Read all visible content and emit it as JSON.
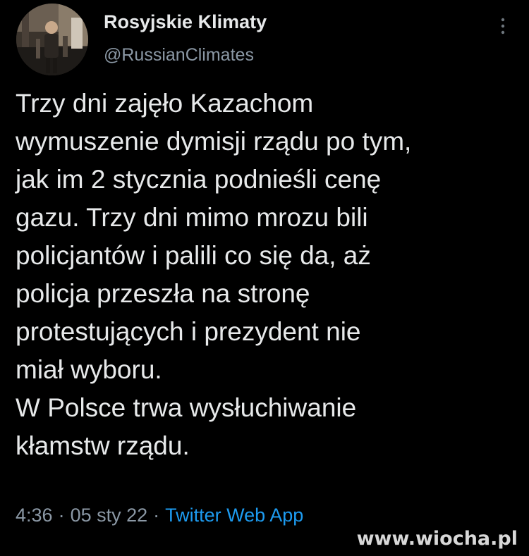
{
  "author": {
    "display_name": "Rosyjskie Klimaty",
    "handle": "@RussianClimates"
  },
  "icons": {
    "more": "vertical-ellipsis",
    "avatar": "profile-photo"
  },
  "tweet": {
    "lines": [
      "Trzy dni zajęło Kazachom",
      "wymuszenie dymisji rządu po tym,",
      "jak im 2 stycznia podnieśli cenę",
      "gazu. Trzy dni mimo mrozu bili",
      "policjantów i palili co się da, aż",
      "policja przeszła na stronę",
      "protestujących i prezydent nie",
      "miał wyboru.",
      "W Polsce trwa wysłuchiwanie",
      "kłamstw rządu."
    ]
  },
  "meta": {
    "time": "4:36",
    "date": "05 sty 22",
    "separator": "·",
    "source": "Twitter Web App"
  },
  "watermark": "www.wiocha.pl",
  "colors": {
    "background": "#000000",
    "text": "#e7e9ea",
    "muted": "#8b98a5",
    "link": "#1d9bf0"
  }
}
